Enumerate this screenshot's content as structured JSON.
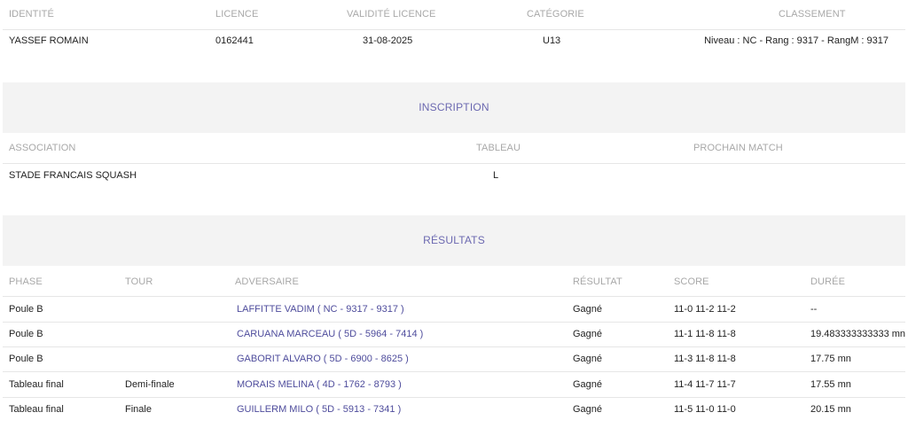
{
  "player": {
    "headers": {
      "identite": "IDENTITÉ",
      "licence": "LICENCE",
      "validite": "VALIDITÉ LICENCE",
      "categorie": "CATÉGORIE",
      "classement": "CLASSEMENT"
    },
    "identite": "YASSEF ROMAIN",
    "licence": "0162441",
    "validite": "31-08-2025",
    "categorie": "U13",
    "classement": "Niveau : NC - Rang : 9317 - RangM : 9317"
  },
  "inscription": {
    "title": "INSCRIPTION",
    "headers": {
      "association": "ASSOCIATION",
      "tableau": "TABLEAU",
      "prochain": "PROCHAIN MATCH"
    },
    "association": "STADE FRANCAIS SQUASH",
    "tableau": "L",
    "prochain": ""
  },
  "resultats": {
    "title": "RÉSULTATS",
    "headers": {
      "phase": "PHASE",
      "tour": "TOUR",
      "adversaire": "ADVERSAIRE",
      "resultat": "RÉSULTAT",
      "score": "SCORE",
      "duree": "DURÉE"
    },
    "rows": [
      {
        "phase": "Poule B",
        "tour": "",
        "adversaire": "LAFFITTE VADIM ( NC - 9317 - 9317 )",
        "resultat": "Gagné",
        "score": "11-0 11-2 11-2",
        "duree": "--"
      },
      {
        "phase": "Poule B",
        "tour": "",
        "adversaire": "CARUANA MARCEAU ( 5D - 5964 - 7414 )",
        "resultat": "Gagné",
        "score": "11-1 11-8 11-8",
        "duree": "19.483333333333 mn"
      },
      {
        "phase": "Poule B",
        "tour": "",
        "adversaire": "GABORIT ALVARO ( 5D - 6900 - 8625 )",
        "resultat": "Gagné",
        "score": "11-3 11-8 11-8",
        "duree": "17.75 mn"
      },
      {
        "phase": "Tableau final",
        "tour": "Demi-finale",
        "adversaire": "MORAIS MELINA ( 4D - 1762 - 8793 )",
        "resultat": "Gagné",
        "score": "11-4 11-7 11-7",
        "duree": "17.55 mn"
      },
      {
        "phase": "Tableau final",
        "tour": "Finale",
        "adversaire": "GUILLERM MILO ( 5D - 5913 - 7341 )",
        "resultat": "Gagné",
        "score": "11-5 11-0 11-0",
        "duree": "20.15 mn"
      }
    ]
  }
}
